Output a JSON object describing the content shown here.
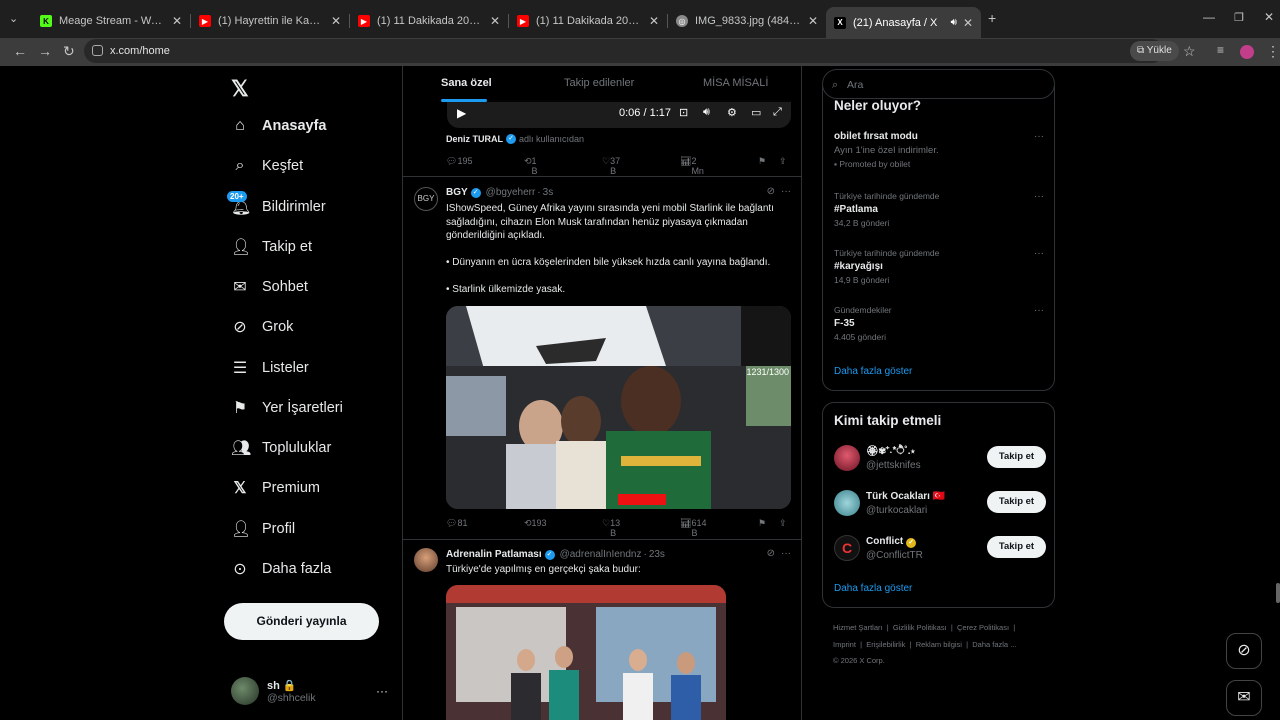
{
  "browser": {
    "tabs": [
      {
        "title": "Meage Stream - Watch Live on",
        "favicon_color": "#53fc18",
        "favicon_glyph": "K"
      },
      {
        "title": "(1) Hayrettin ile Kaos Show - 2...",
        "favicon_color": "#ff0000",
        "favicon_glyph": "▶"
      },
      {
        "title": "(1) 11 Dakikada 2025 - YouTube",
        "favicon_color": "#ff0000",
        "favicon_glyph": "▶"
      },
      {
        "title": "(1) 11 Dakikada 2025 - YouTube",
        "favicon_color": "#ff0000",
        "favicon_glyph": "▶"
      },
      {
        "title": "IMG_9833.jpg (484×645)",
        "favicon_color": "#8a8a8a",
        "favicon_glyph": "◎"
      },
      {
        "title": "(21) Anasayfa / X",
        "favicon_color": "#000000",
        "favicon_glyph": "X"
      }
    ],
    "url": "x.com/home",
    "install_label": "Yükle"
  },
  "nav": {
    "items": [
      {
        "label": "Anasayfa",
        "icon": "home-icon"
      },
      {
        "label": "Keşfet",
        "icon": "search-icon"
      },
      {
        "label": "Bildirimler",
        "icon": "bell-icon",
        "badge": "20+"
      },
      {
        "label": "Takip et",
        "icon": "add-user-icon"
      },
      {
        "label": "Sohbet",
        "icon": "mail-icon"
      },
      {
        "label": "Grok",
        "icon": "grok-icon"
      },
      {
        "label": "Listeler",
        "icon": "list-icon"
      },
      {
        "label": "Yer İşaretleri",
        "icon": "bookmark-icon"
      },
      {
        "label": "Topluluklar",
        "icon": "communities-icon"
      },
      {
        "label": "Premium",
        "icon": "x-logo-icon"
      },
      {
        "label": "Profil",
        "icon": "profile-icon"
      },
      {
        "label": "Daha fazla",
        "icon": "more-circle-icon"
      }
    ],
    "post_button": "Gönderi yayınla",
    "account": {
      "name": "sh 🔒",
      "handle": "@shhcelik"
    }
  },
  "feed": {
    "tabs": [
      "Sana özel",
      "Takip edilenler",
      "MİSA MİSALİ"
    ],
    "video_time": "0:06 / 1:17",
    "prev_post": {
      "quoted_from": "Deniz TURAL",
      "quoted_note": "adlı kullanıcıdan",
      "replies": "195",
      "reposts": "1 B",
      "likes": "37 B",
      "views": "2 Mn"
    },
    "posts": [
      {
        "name": "BGY",
        "handle": "@bgyeherr",
        "time": "3s",
        "text": [
          "IShowSpeed, Güney Afrika yayını sırasında yeni mobil Starlink ile bağlantı sağladığını, cihazın Elon Musk tarafından henüz piyasaya çıkmadan gönderildiğini açıkladı.",
          "• Dünyanın en ücra köşelerinden bile yüksek hızda canlı yayına bağlandı.",
          "• Starlink ülkemizde yasak."
        ],
        "media_overlay": "1231/1300",
        "replies": "81",
        "reposts": "193",
        "likes": "13 B",
        "views": "614 B"
      },
      {
        "name": "Adrenalin Patlaması",
        "handle": "@adrenalInIendnz",
        "time": "23s",
        "text": [
          "Türkiye'de yapılmış en gerçekçi şaka budur:"
        ]
      }
    ]
  },
  "right": {
    "search_placeholder": "Ara",
    "happening_title": "Neler oluyor?",
    "trends": [
      {
        "context": "",
        "title": "obilet fırsat modu",
        "sub": "Ayın 1'ine özel indirimler.",
        "promo": "Promoted by obilet"
      },
      {
        "context": "Türkiye tarihinde gündemde",
        "title": "#Patlama",
        "sub": "34,2 B gönderi"
      },
      {
        "context": "Türkiye tarihinde gündemde",
        "title": "#karyağışı",
        "sub": "14,9 B gönderi"
      },
      {
        "context": "Gündemdekiler",
        "title": "F-35",
        "sub": "4.405 gönderi"
      }
    ],
    "show_more": "Daha fazla göster",
    "who_title": "Kimi takip etmeli",
    "who": [
      {
        "name": "🏵✾⁺˖*ੈ˚.⋆",
        "handle": "@jettsknifes",
        "follow": "Takip et",
        "color": "#c0304a"
      },
      {
        "name": "Türk Ocakları 🇹🇷",
        "handle": "@turkocaklari",
        "follow": "Takip et",
        "color": "#3a7f8a"
      },
      {
        "name": "Conflict",
        "handle": "@ConflictTR",
        "follow": "Takip et",
        "color": "#111111"
      }
    ],
    "who_more": "Daha fazla göster",
    "footer": [
      "Hizmet Şartları",
      "Gizlilik Politikası",
      "Çerez Politikası",
      "Imprint",
      "Erişilebilirlik",
      "Reklam bilgisi",
      "Daha fazla ...",
      "© 2026 X Corp."
    ]
  },
  "colors": {
    "accent": "#1d9bf0",
    "background": "#000000",
    "border": "#2f3336",
    "muted": "#71767b"
  }
}
